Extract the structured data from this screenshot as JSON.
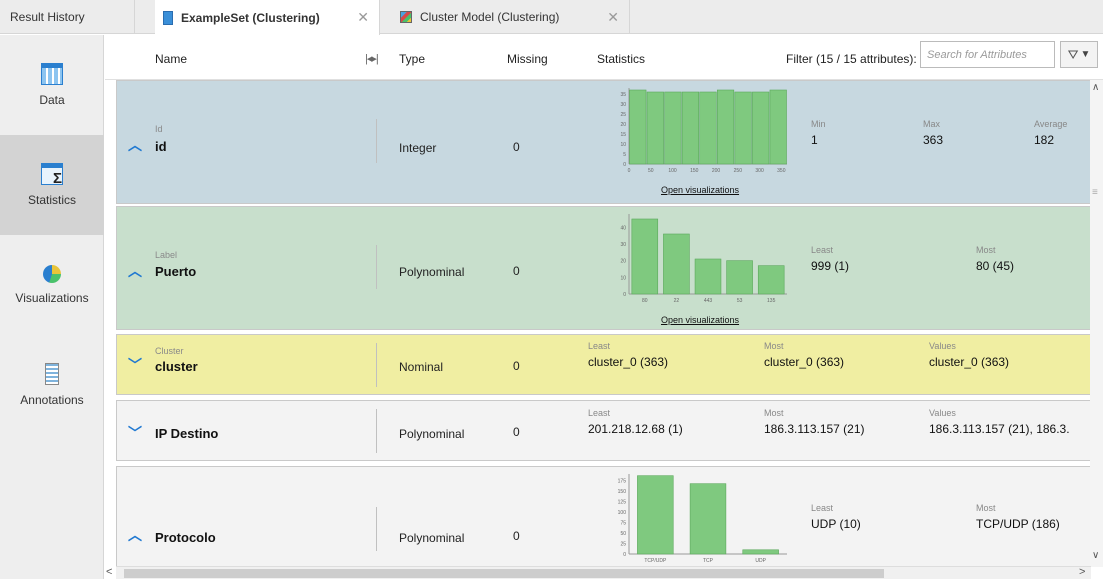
{
  "tabs": [
    {
      "label": "Result History",
      "close": ""
    },
    {
      "label": "ExampleSet (Clustering)",
      "close": "✕"
    },
    {
      "label": "Cluster Model (Clustering)",
      "close": "✕"
    }
  ],
  "sidebar": {
    "items": [
      {
        "label": "Data",
        "icon": "table-icon"
      },
      {
        "label": "Statistics",
        "icon": "statistics-icon"
      },
      {
        "label": "Visualizations",
        "icon": "visualizations-icon"
      },
      {
        "label": "Annotations",
        "icon": "annotations-icon"
      }
    ],
    "active": "Statistics"
  },
  "header": {
    "name": "Name",
    "type": "Type",
    "missing": "Missing",
    "statistics": "Statistics",
    "filter_label": "Filter (15 / 15 attributes):",
    "search_placeholder": "Search for Attributes",
    "filter_button": "▼"
  },
  "attributes": [
    {
      "role": "Id",
      "name": "id",
      "type": "Integer",
      "missing": "0",
      "expanded": true,
      "color": "#c7d8e0",
      "open_vis": "Open visualizations",
      "stats": [
        {
          "label": "Min",
          "value": "1"
        },
        {
          "label": "Max",
          "value": "363"
        },
        {
          "label": "Average",
          "value": "182"
        }
      ],
      "histogram": {
        "bins": [
          37,
          36,
          36,
          36,
          36,
          37,
          36,
          36,
          37
        ],
        "ymax": 35,
        "yticks": [
          "35",
          "30",
          "25",
          "20",
          "15",
          "10",
          "5",
          "0"
        ],
        "xticks": [
          "0",
          "50",
          "100",
          "150",
          "200",
          "250",
          "300",
          "350"
        ]
      }
    },
    {
      "role": "Label",
      "name": "Puerto",
      "type": "Polynominal",
      "missing": "0",
      "expanded": true,
      "color": "#c8dfcc",
      "open_vis": "Open visualizations",
      "stats": [
        {
          "label": "Least",
          "value": "999 (1)"
        },
        {
          "label": "Most",
          "value": "80 (45)"
        }
      ],
      "histogram": {
        "categories": [
          "80",
          "22",
          "443",
          "53",
          "135"
        ],
        "values": [
          45,
          36,
          21,
          20,
          17
        ],
        "yticks": [
          "40",
          "30",
          "20",
          "10",
          "0"
        ]
      }
    },
    {
      "role": "Cluster",
      "name": "cluster",
      "type": "Nominal",
      "missing": "0",
      "expanded": false,
      "color": "#f0eea2",
      "stats": [
        {
          "label": "Least",
          "value": "cluster_0 (363)"
        },
        {
          "label": "Most",
          "value": "cluster_0 (363)"
        },
        {
          "label": "Values",
          "value": "cluster_0 (363)"
        }
      ]
    },
    {
      "role": "",
      "name": "IP Destino",
      "type": "Polynominal",
      "missing": "0",
      "expanded": false,
      "color": "#f3f3f3",
      "stats": [
        {
          "label": "Least",
          "value": "201.218.12.68 (1)"
        },
        {
          "label": "Most",
          "value": "186.3.113.157 (21)"
        },
        {
          "label": "Values",
          "value": "186.3.113.157 (21), 186.3."
        }
      ]
    },
    {
      "role": "",
      "name": "Protocolo",
      "type": "Polynominal",
      "missing": "0",
      "expanded": true,
      "color": "#f3f3f3",
      "stats": [
        {
          "label": "Least",
          "value": "UDP (10)"
        },
        {
          "label": "Most",
          "value": "TCP/UDP (186)"
        }
      ],
      "histogram": {
        "categories": [
          "TCP/UDP",
          "TCP",
          "UDP"
        ],
        "values": [
          186,
          167,
          10
        ],
        "yticks": [
          "175",
          "150",
          "125",
          "100",
          "75",
          "50",
          "25",
          "0"
        ]
      }
    }
  ],
  "colors": {
    "bar_fill": "#7fc97f",
    "bar_stroke": "#5aa85a",
    "chevron": "#1f78d1"
  }
}
